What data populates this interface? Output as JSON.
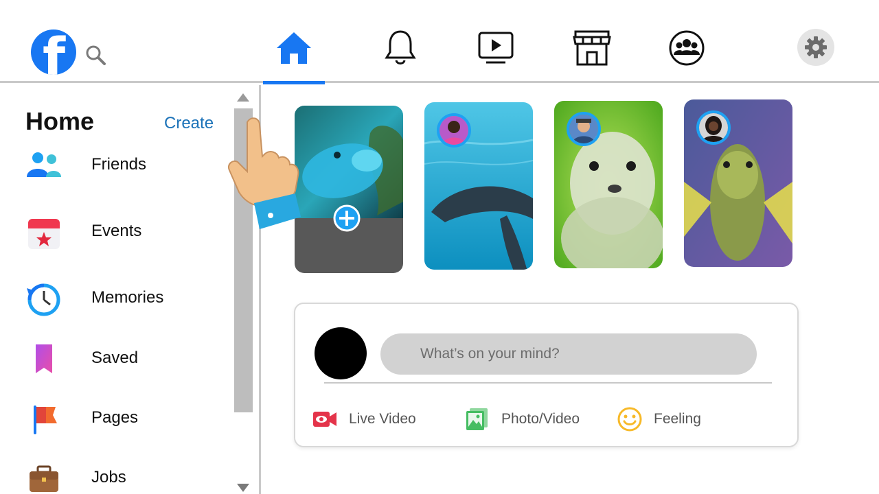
{
  "topbar": {
    "logo_letter": "f",
    "nav": [
      {
        "name": "home-icon",
        "active": true
      },
      {
        "name": "bell-icon",
        "active": false
      },
      {
        "name": "watch-icon",
        "active": false
      },
      {
        "name": "marketplace-icon",
        "active": false
      },
      {
        "name": "groups-icon",
        "active": false
      }
    ],
    "accent_color": "#1877f2"
  },
  "sidebar": {
    "title": "Home",
    "create_label": "Create",
    "items": [
      {
        "label": "Friends",
        "icon": "friends-icon"
      },
      {
        "label": "Events",
        "icon": "calendar-icon"
      },
      {
        "label": "Memories",
        "icon": "clock-icon"
      },
      {
        "label": "Saved",
        "icon": "bookmark-icon"
      },
      {
        "label": "Pages",
        "icon": "flag-icon"
      },
      {
        "label": "Jobs",
        "icon": "briefcase-icon"
      }
    ]
  },
  "stories": [
    {
      "name": "create-story",
      "image": "parrotfish"
    },
    {
      "name": "story-1",
      "image": "dolphin"
    },
    {
      "name": "story-2",
      "image": "seal"
    },
    {
      "name": "story-3",
      "image": "lionfish"
    }
  ],
  "composer": {
    "placeholder": "What’s on your mind?",
    "actions": [
      {
        "label": "Live Video",
        "icon": "live-video-icon",
        "color": "#e4344a"
      },
      {
        "label": "Photo/Video",
        "icon": "photo-icon",
        "color": "#45bd62"
      },
      {
        "label": "Feeling",
        "icon": "smiley-icon",
        "color": "#f7b928"
      }
    ]
  }
}
